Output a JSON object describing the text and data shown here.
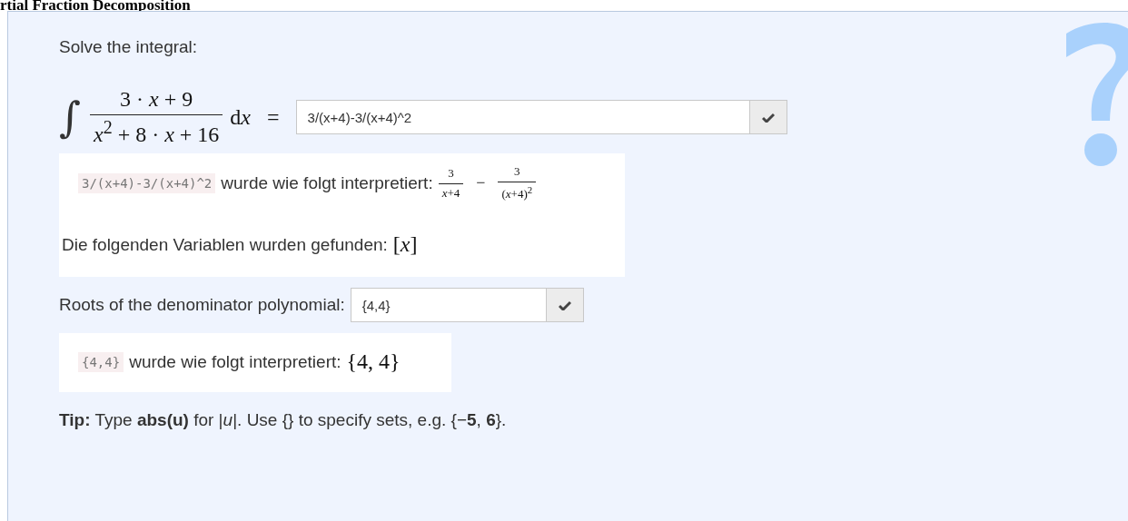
{
  "heading": "rtial Fraction Decomposition",
  "prompt": "Solve the integral:",
  "integral": {
    "sign": "∫",
    "numerator": "3 · *x* + 9",
    "denominator": "*x*$^{2}$ + 8 · *x* + 16",
    "differential": "d",
    "variable": "x",
    "equals": "="
  },
  "answer_field": {
    "value": "3/(x+4)-3/(x+4)^2"
  },
  "feedback": {
    "code": "3/(x+4)-3/(x+4)^2",
    "text": "wurde wie folgt interpretiert:",
    "minus": "−",
    "terms": [
      {
        "numerator": "3",
        "denominator": "*x*+4"
      },
      {
        "numerator": "3",
        "denominator": "(*x*+4)$^{2}$"
      }
    ],
    "variables_text": "Die folgenden Variablen wurden gefunden:",
    "variables": "[*x*]"
  },
  "roots": {
    "label": "Roots of the denominator polynomial:",
    "value": "{4,4}"
  },
  "roots_feedback": {
    "code": "{4,4}",
    "text": "wurde wie folgt interpretiert:",
    "result": "{4, 4}"
  },
  "tip": "**Tip:** Type **abs(u)** for |*u*|. Use {} to specify sets, e.g. {−**5**, **6**}."
}
